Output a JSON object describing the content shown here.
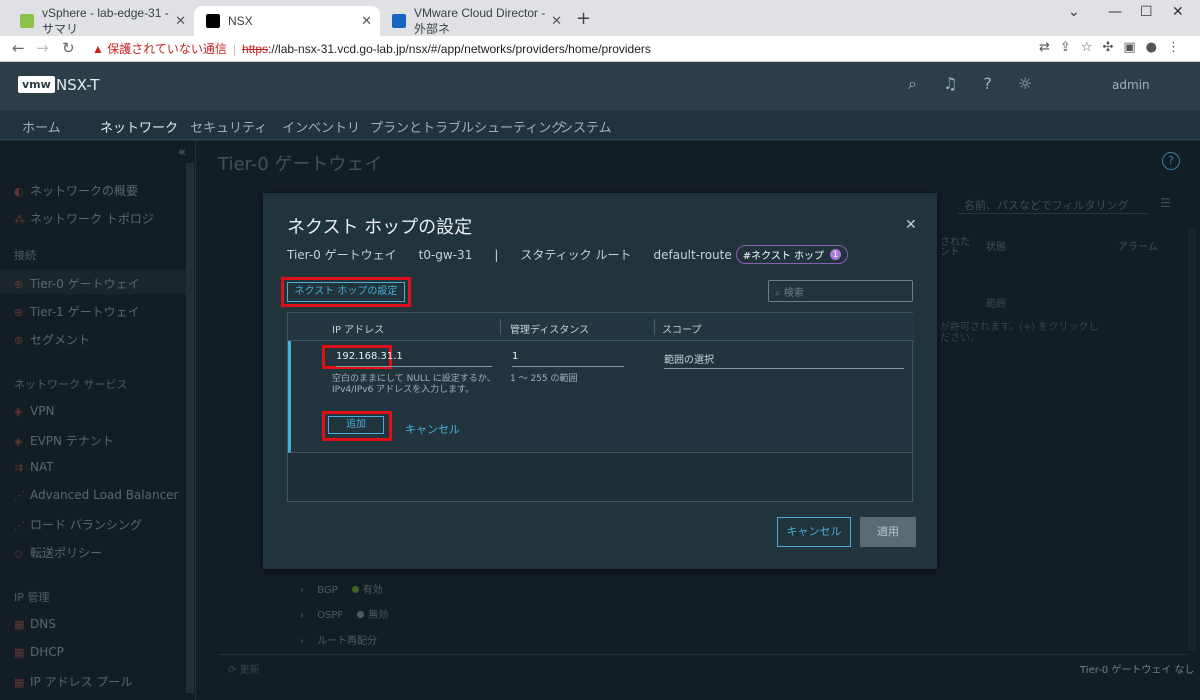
{
  "browser": {
    "tabs": [
      {
        "title": "vSphere - lab-edge-31 - サマリ",
        "favicon_color": "#8bc34a"
      },
      {
        "title": "NSX",
        "favicon_color": "#000000"
      },
      {
        "title": "VMware Cloud Director - 外部ネ",
        "favicon_color": "#1565c0"
      }
    ],
    "security_warning": "保護されていない通信",
    "url_scheme": "https",
    "url_rest": "://lab-nsx-31.vcd.go-lab.jp/nsx/#/app/networks/providers/home/providers"
  },
  "app": {
    "logo": "vmw",
    "product": "NSX-T",
    "user": "admin",
    "nav_tabs": [
      "ホーム",
      "ネットワーク",
      "セキュリティ",
      "インベントリ",
      "プランとトラブルシューティング",
      "システム"
    ],
    "active_tab": "ネットワーク"
  },
  "sidebar": {
    "overview": "ネットワークの概要",
    "topology": "ネットワーク トポロジ",
    "section_connectivity": "接続",
    "tier0": "Tier-0 ゲートウェイ",
    "tier1": "Tier-1 ゲートウェイ",
    "segment": "セグメント",
    "section_services": "ネットワーク サービス",
    "vpn": "VPN",
    "evpn": "EVPN テナント",
    "nat": "NAT",
    "alb": "Advanced Load Balancer",
    "lb": "ロード バランシング",
    "forwarding": "転送ポリシー",
    "section_ip": "IP 管理",
    "dns": "DNS",
    "dhcp": "DHCP",
    "ippool": "IP アドレス プール"
  },
  "background": {
    "title": "Tier-0 ゲートウェイ",
    "filter_placeholder": "名前、パスなどでフィルタリング",
    "col_status": "状態",
    "col_alarm": "アラーム",
    "col_partial": "された\nント",
    "range_text": "範囲",
    "msg_partial": "が許可されます。(+) をクリックし",
    "msg_partial2": "ださい。",
    "bgp_label": "BGP",
    "bgp_status": "有効",
    "ospf_label": "OSPF",
    "ospf_status": "無効",
    "redistribution": "ルート再配分",
    "refresh": "更新",
    "footer_none": "Tier-0 ゲートウェイ なし"
  },
  "modal": {
    "title": "ネクスト ホップの設定",
    "breadcrumb": {
      "gw_type": "Tier-0 ゲートウェイ",
      "gw_name": "t0-gw-31",
      "sep": "|",
      "route_type": "スタティック ルート",
      "route_name": "default-route",
      "badge": "#ネクスト ホップ",
      "badge_count": "1"
    },
    "set_next_hop_button": "ネクスト ホップの設定",
    "search_placeholder": "検索",
    "columns": {
      "ip": "IP アドレス",
      "distance": "管理ディスタンス",
      "scope": "スコープ"
    },
    "row": {
      "ip": "192.168.31.1",
      "ip_hint": "空白のままにして NULL に設定するか、IPv4/IPv6 アドレスを入力します。",
      "distance": "1",
      "distance_hint": "1 〜 255 の範囲",
      "scope_placeholder": "範囲の選択",
      "add_button": "追加",
      "cancel_link": "キャンセル"
    },
    "cancel_button": "キャンセル",
    "apply_button": "適用"
  }
}
